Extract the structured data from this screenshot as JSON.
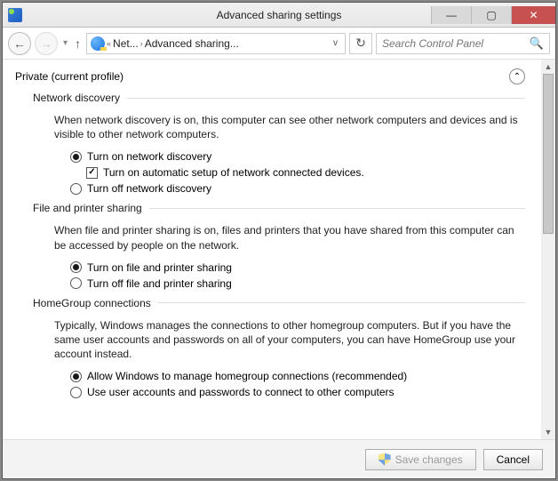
{
  "title": "Advanced sharing settings",
  "nav": {
    "crumb1": "Net...",
    "crumb2": "Advanced sharing...",
    "searchPlaceholder": "Search Control Panel"
  },
  "profile": {
    "label": "Private (current profile)"
  },
  "sections": {
    "discovery": {
      "title": "Network discovery",
      "desc": "When network discovery is on, this computer can see other network computers and devices and is visible to other network computers.",
      "optOn": "Turn on network discovery",
      "optAuto": "Turn on automatic setup of network connected devices.",
      "optOff": "Turn off network discovery"
    },
    "fileprint": {
      "title": "File and printer sharing",
      "desc": "When file and printer sharing is on, files and printers that you have shared from this computer can be accessed by people on the network.",
      "optOn": "Turn on file and printer sharing",
      "optOff": "Turn off file and printer sharing"
    },
    "homegroup": {
      "title": "HomeGroup connections",
      "desc": "Typically, Windows manages the connections to other homegroup computers. But if you have the same user accounts and passwords on all of your computers, you can have HomeGroup use your account instead.",
      "optAllow": "Allow Windows to manage homegroup connections (recommended)",
      "optUser": "Use user accounts and passwords to connect to other computers"
    }
  },
  "buttons": {
    "save": "Save changes",
    "cancel": "Cancel"
  }
}
